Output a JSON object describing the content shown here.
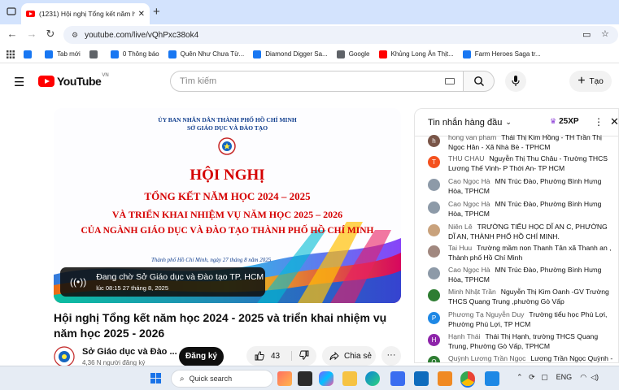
{
  "browser": {
    "tab_title": "(1231) Hội nghị Tổng kết năm h",
    "url": "youtube.com/live/vQhPxc38ok4",
    "bookmarks": [
      {
        "label": "",
        "color": "#1877f2"
      },
      {
        "label": "Tab mới",
        "color": "#1877f2"
      },
      {
        "label": "",
        "color": "#5f6368"
      },
      {
        "label": "0 Thông báo",
        "color": "#1877f2"
      },
      {
        "label": "Quên Như Chưa Từ...",
        "color": "#1877f2"
      },
      {
        "label": "Diamond Digger Sa...",
        "color": "#1877f2"
      },
      {
        "label": "Google",
        "color": "#5f6368"
      },
      {
        "label": "Khủng Long Ăn Thịt...",
        "color": "#ff0000"
      },
      {
        "label": "Farm Heroes Saga tr...",
        "color": "#1877f2"
      }
    ]
  },
  "youtube": {
    "logo": "YouTube",
    "country_code": "VN",
    "search_placeholder": "Tìm kiếm",
    "create_label": "Tạo"
  },
  "banner": {
    "org_line1": "ỦY BAN NHÂN DÂN THÀNH PHỐ HỒ CHÍ MINH",
    "org_line2": "SỞ GIÁO DỤC VÀ ĐÀO TẠO",
    "heading": "HỘI NGHỊ",
    "line1": "TỔNG KẾT NĂM HỌC 2024 – 2025",
    "line2": "VÀ TRIỂN KHAI NHIỆM VỤ NĂM HỌC 2025 – 2026",
    "line3": "CỦA NGÀNH GIÁO DỤC VÀ ĐÀO TẠO THÀNH PHỐ HỒ CHÍ MINH",
    "place_date": "Thành phố Hồ Chí Minh, ngày 27 tháng 8 năm 2025"
  },
  "live_overlay": {
    "status": "Đang chờ Sở Giáo dục và Đào tạo TP. HCM",
    "time": "lúc 08:15 27 tháng 8, 2025"
  },
  "video": {
    "title": "Hội nghị Tổng kết năm học 2024 - 2025 và triển khai nhiệm vụ năm học 2025 - 2026",
    "channel": "Sở Giáo dục và Đào ...",
    "subscribers": "4,36 N người đăng ký",
    "subscribe_label": "Đăng ký",
    "likes": "43",
    "share_label": "Chia sẻ"
  },
  "chat": {
    "header": "Tin nhắn hàng đầu",
    "xp": "25XP",
    "messages": [
      {
        "author": "hong van pham",
        "text": "Thái Thị Kim Hồng - TH Trần Thị Ngọc Hân - Xã Nhà Bè - TPHCM",
        "avatar": "h",
        "color": "#795548"
      },
      {
        "author": "THU CHAU",
        "text": "Nguyễn Thị Thu Châu - Trường THCS Lương Thế Vinh- P Thới An- TP HCM",
        "avatar": "T",
        "color": "#f4511e"
      },
      {
        "author": "Cao Ngọc Hà",
        "text": "MN Trúc Đào, Phường Bình Hưng Hòa, TPHCM",
        "avatar": "",
        "color": "#8d9aa8"
      },
      {
        "author": "Cao Ngọc Hà",
        "text": "MN Trúc Đào, Phường Bình Hưng Hòa, TPHCM",
        "avatar": "",
        "color": "#8d9aa8"
      },
      {
        "author": "Niên Lê",
        "text": "TRƯỜNG TIỂU HỌC DĨ AN C, PHƯỜNG DĨ AN, THÀNH PHỐ HỒ CHÍ MINH.",
        "avatar": "",
        "color": "#c9a27c"
      },
      {
        "author": "Tai Huu",
        "text": "Trường mầm non Thanh Tân xã Thanh an , Thành phố Hồ Chí Minh",
        "avatar": "",
        "color": "#a1887f"
      },
      {
        "author": "Cao Ngọc Hà",
        "text": "MN Trúc Đào, Phường Bình Hưng Hòa, TPHCM",
        "avatar": "",
        "color": "#8d9aa8"
      },
      {
        "author": "Minh Nhật Trần",
        "text": "Nguyễn Thị Kim Oanh -GV Trường THCS Quang Trung ,phường Gò Vấp",
        "avatar": "",
        "color": "#2e7d32"
      },
      {
        "author": "Phương Tạ Nguyễn Duy",
        "text": "Trường tiểu học Phú Lợi, Phường Phú Lợi, TP HCM",
        "avatar": "P",
        "color": "#1e88e5"
      },
      {
        "author": "Hạnh Thái",
        "text": "Thái Thị Hạnh, trường THCS Quang Trung, Phường Gò Vấp, TPHCM",
        "avatar": "H",
        "color": "#8e24aa"
      },
      {
        "author": "Quỳnh Lương Trần Ngọc",
        "text": "Lương Trần Ngọc Quỳnh - THPT Marie Curie ToHCM",
        "avatar": "Q",
        "color": "#2e7d32"
      }
    ]
  },
  "taskbar": {
    "search_label": "Quick search",
    "language": "ENG"
  }
}
